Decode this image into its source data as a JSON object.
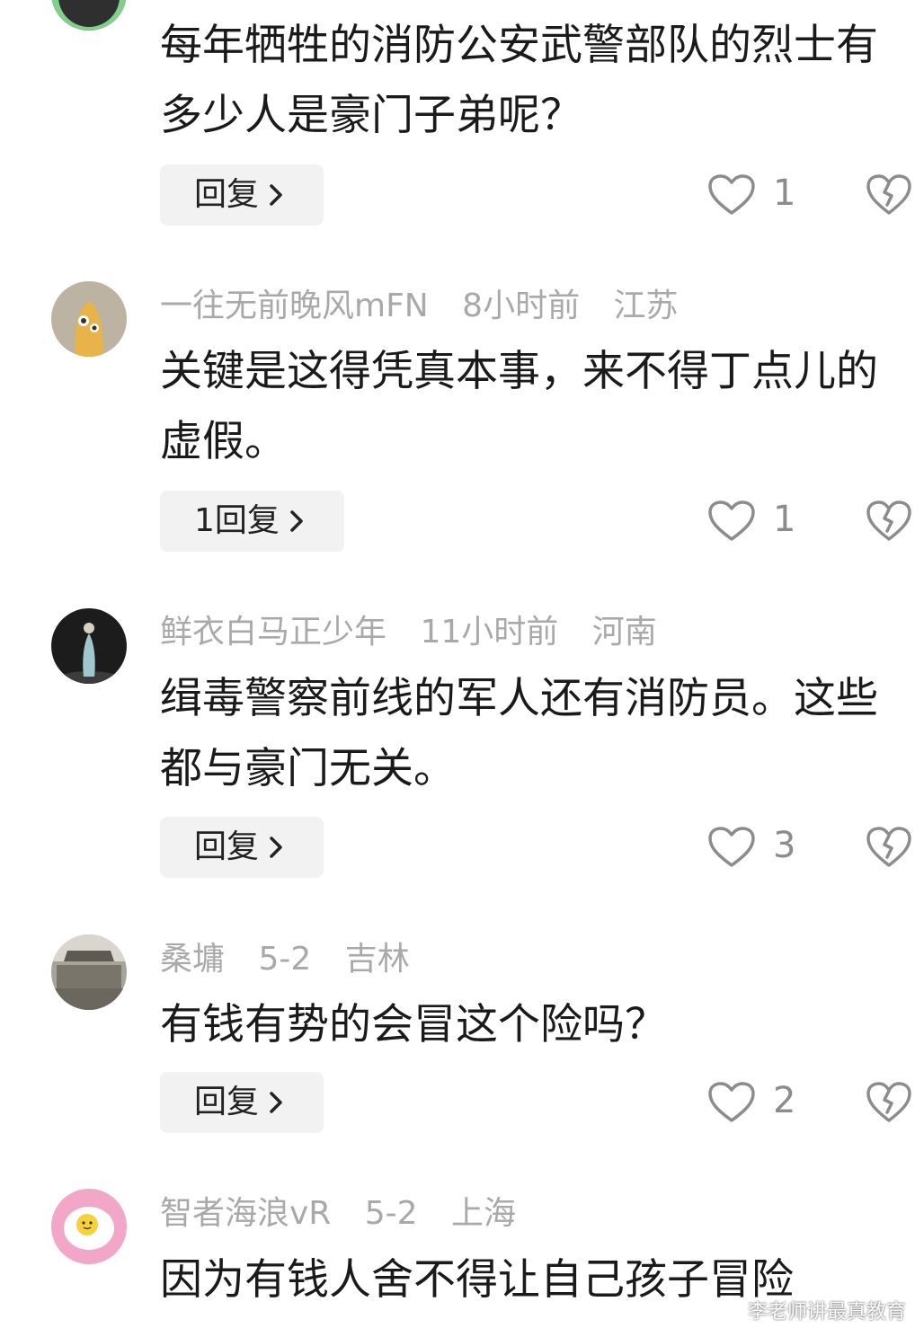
{
  "comments": [
    {
      "username": "",
      "time": "",
      "location": "",
      "text": "每年牺牲的消防公安武警部队的烈士有多少人是豪门子弟呢？",
      "reply_label": "回复",
      "likes": "1"
    },
    {
      "username": "一往无前晚风mFN",
      "time": "8小时前",
      "location": "江苏",
      "text": "关键是这得凭真本事，来不得丁点儿的虚假。",
      "reply_label": "1回复",
      "likes": "1"
    },
    {
      "username": "鲜衣白马正少年",
      "time": "11小时前",
      "location": "河南",
      "text": "缉毒警察前线的军人还有消防员。这些都与豪门无关。",
      "reply_label": "回复",
      "likes": "3"
    },
    {
      "username": "桑墉",
      "time": "5-2",
      "location": "吉林",
      "text": "有钱有势的会冒这个险吗？",
      "reply_label": "回复",
      "likes": "2"
    },
    {
      "username": "智者海浪vR",
      "time": "5-2",
      "location": "上海",
      "text": "因为有钱人舍不得让自己孩子冒险",
      "reply_label": "",
      "likes": ""
    }
  ],
  "watermark": "李老师讲最真教育",
  "icons": {
    "like": "heart-outline-icon",
    "dislike": "broken-heart-icon",
    "reply_arrow": "chevron-right-icon"
  },
  "colors": {
    "text": "#1a1a1a",
    "meta": "#a9a9a9",
    "count": "#8c8c8c",
    "reply_bg": "#f2f2f2"
  }
}
